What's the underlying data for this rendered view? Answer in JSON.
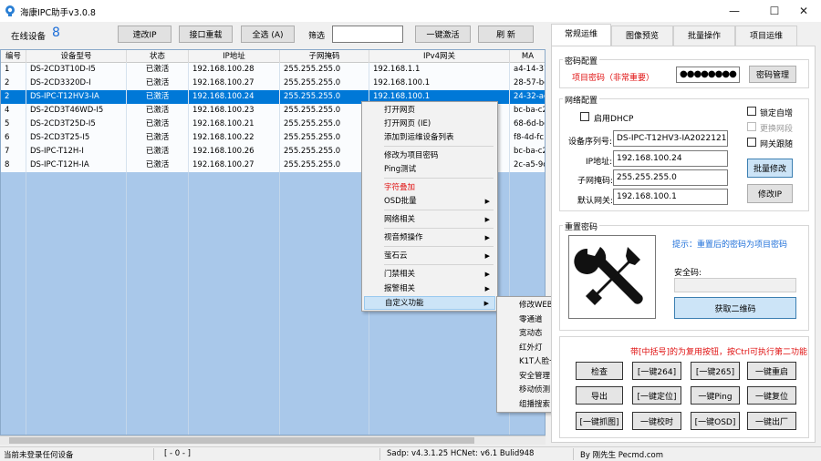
{
  "window": {
    "title": "海康IPC助手v3.0.8",
    "controls": [
      "—",
      "☐",
      "✕"
    ]
  },
  "toolbar": {
    "online_label": "在线设备",
    "online_count": "8",
    "speed_ip": "速改IP",
    "port_reset": "接口重载",
    "select_all": "全选 (A)",
    "filter_label": "筛选",
    "filter_value": "",
    "one_key_activate": "一键激活",
    "refresh": "刷 新"
  },
  "table": {
    "columns": [
      "编号",
      "设备型号",
      "状态",
      "IP地址",
      "子网掩码",
      "IPv4网关",
      "MA"
    ],
    "rows": [
      [
        "1",
        "DS-2CD3T10D-I5",
        "已激活",
        "192.168.100.28",
        "255.255.255.0",
        "192.168.1.1",
        "a4-14-37"
      ],
      [
        "2",
        "DS-2CD3320D-I",
        "已激活",
        "192.168.100.27",
        "255.255.255.0",
        "192.168.100.1",
        "28-57-be"
      ],
      [
        "2",
        "DS-IPC-T12HV3-IA",
        "已激活",
        "192.168.100.24",
        "255.255.255.0",
        "192.168.100.1",
        "24-32-ae"
      ],
      [
        "4",
        "DS-2CD3T46WD-I5",
        "已激活",
        "192.168.100.23",
        "255.255.255.0",
        "",
        "bc-ba-c2"
      ],
      [
        "5",
        "DS-2CD3T25D-I5",
        "已激活",
        "192.168.100.21",
        "255.255.255.0",
        "",
        "68-6d-bc"
      ],
      [
        "6",
        "DS-2CD3T25-I5",
        "已激活",
        "192.168.100.22",
        "255.255.255.0",
        "",
        "f8-4d-fc"
      ],
      [
        "7",
        "DS-IPC-T12H-I",
        "已激活",
        "192.168.100.26",
        "255.255.255.0",
        "",
        "bc-ba-c2"
      ],
      [
        "8",
        "DS-IPC-T12H-IA",
        "已激活",
        "192.168.100.27",
        "255.255.255.0",
        "",
        "2c-a5-9c"
      ]
    ],
    "selected_row": 2
  },
  "context_menu": {
    "items": [
      {
        "label": "打开网页",
        "sub": false,
        "red": false
      },
      {
        "label": "打开网页 (IE)",
        "sub": false,
        "red": false
      },
      {
        "label": "添加到运维设备列表",
        "sub": false,
        "red": false
      },
      {
        "label": "修改为项目密码",
        "sub": false,
        "red": false
      },
      {
        "label": "Ping测试",
        "sub": false,
        "red": false
      },
      {
        "label": "字符叠加",
        "sub": false,
        "red": true
      },
      {
        "label": "OSD批量",
        "sub": true,
        "red": false
      },
      {
        "label": "网络相关",
        "sub": true,
        "red": false
      },
      {
        "label": "视音频操作",
        "sub": true,
        "red": false
      },
      {
        "label": "萤石云",
        "sub": true,
        "red": false
      },
      {
        "label": "门禁相关",
        "sub": true,
        "red": false
      },
      {
        "label": "报警相关",
        "sub": true,
        "red": false
      },
      {
        "label": "自定义功能",
        "sub": true,
        "red": false
      }
    ],
    "highlighted": "自定义功能"
  },
  "submenu": {
    "items": [
      {
        "label": "修改WEB端口",
        "sub": false
      },
      {
        "label": "零通道",
        "sub": true
      },
      {
        "label": "宽动态",
        "sub": true
      },
      {
        "label": "红外灯",
        "sub": true
      },
      {
        "label": "K1T人脸一体机",
        "sub": true
      },
      {
        "label": "安全管理",
        "sub": true
      },
      {
        "label": "移动侦测",
        "sub": true
      },
      {
        "label": "组播搜索",
        "sub": true
      }
    ]
  },
  "tabs": [
    "常规运维",
    "图像预览",
    "批量操作",
    "项目运维"
  ],
  "active_tab": 0,
  "password_config": {
    "title": "密码配置",
    "label": "项目密码（非常重要）",
    "value": "●●●●●●●●",
    "manage_btn": "密码管理"
  },
  "network_config": {
    "title": "网络配置",
    "dhcp_label": "启用DHCP",
    "lock_label": "锁定自增",
    "change_gw_label": "更换网段",
    "gw_follow_label": "网关跟随",
    "serial_label": "设备序列号:",
    "serial_value": "DS-IPC-T12HV3-IA20221210A",
    "ip_label": "IP地址:",
    "ip_value": "192.168.100.24",
    "mask_label": "子网掩码:",
    "mask_value": "255.255.255.0",
    "gw_label": "默认网关:",
    "gw_value": "192.168.100.1",
    "batch_modify_btn": "批量修改",
    "modify_ip_btn": "修改IP"
  },
  "reset_password": {
    "title": "重置密码",
    "hint": "提示：重置后的密码为项目密码",
    "security_code_label": "安全码:",
    "security_code_value": "",
    "get_qr_btn": "获取二维码",
    "icon": "tools-icon"
  },
  "func_buttons": {
    "note": "带[中括号]的为复用按钮，按Ctrl可执行第二功能",
    "buttons": [
      "检查",
      "[一键264]",
      "[一键265]",
      "一键重启",
      "导出",
      "[一键定位]",
      "一键Ping",
      "一键复位",
      "[一键抓图]",
      "一键校时",
      "[一键OSD]",
      "一键出厂"
    ]
  },
  "status_bar": {
    "login": "当前未登录任何设备",
    "count": "[ - 0 - ]",
    "version": "Sadp:  v4.3.1.25   HCNet:  v6.1 Bulid948",
    "author": "By 刚先生 Pecmd.com"
  },
  "colors": {
    "accent": "#0078d7",
    "table_bg": "#a9c8ea",
    "red_text": "#e01010",
    "link_blue": "#1e6fd9"
  }
}
